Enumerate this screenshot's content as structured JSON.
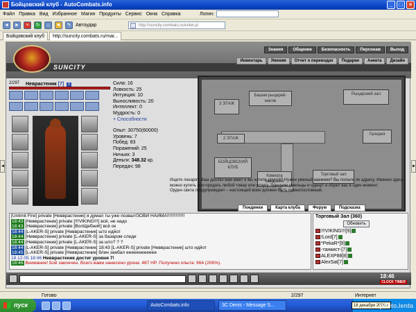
{
  "window": {
    "title": "Бойцовский клуб - AutoCombats.info"
  },
  "menu": [
    "Файл",
    "Правка",
    "Вид",
    "Избранное",
    "Магия",
    "Продукты",
    "Сервис",
    "Окна",
    "Справка"
  ],
  "logon_label": "Логин:",
  "toolbar": {
    "autocomplete": "Автоудар"
  },
  "address": "http://suncity.combats.ru/enter.pl",
  "tabs": [
    "Бойцовский клуб",
    "http://suncity.combats.ru/mai..."
  ],
  "site": {
    "brand": "SUNCITY",
    "top_links": [
      "Знания",
      "Общение",
      "Безопасность",
      "Персонаж",
      "Выход"
    ],
    "sub_links": [
      "Инвентарь",
      "Умения",
      "Отчет о переводах",
      "Подарки",
      "Анкета",
      "Дизайн"
    ]
  },
  "character": {
    "name": "Неврастеник",
    "level": "[7]",
    "hp": "2/297",
    "stats": [
      "Сила: 16",
      "Ловкость: 25",
      "Интуиция: 10",
      "Выносливость: 20",
      "Интеллект: 0",
      "Мудрость: 0"
    ],
    "abilities_link": "+ Способности",
    "info": [
      "Опыт: 30750(60000)",
      "Уровень: 7",
      "Побед: 83",
      "Поражений: 25",
      "Ничьих: 3"
    ],
    "money_label": "Деньги:",
    "money": "348.32",
    "money_unit": "кр.",
    "transfers": "Передач: 98"
  },
  "map": {
    "rooms": {
      "floor3": "3 ЭТАЖ",
      "knights": "Башня рыцарей-магов",
      "knight_hall": "Рыцарский зал",
      "floor2": "2 ЭТАЖ",
      "gallery": "Галерея",
      "club": "БОЙЦОВСКИЙ КЛУБ",
      "waiting": "Комната ожидания",
      "trade": "Торговый зал"
    },
    "description": "Ищете лекаря? Ваш доспех вам жмет и вы хотите другой? Нужен умелый наемник? Вы попали по адресу. Именно здесь можно купить или продать любой товар или услугу. Здешние умельцы и оденут и обуют вас в один момент.",
    "warning": "Орден света предупреждает – настоящий воин должен быть немногословным."
  },
  "nav_buttons": [
    "Поединки",
    "Карта клуба",
    "Форум",
    "Подсказка"
  ],
  "chat": [
    {
      "time": "",
      "text": "[Unlimit Fire] private [Невврастеник] я думал ты уже позвал!ЗОВИ НАЙМА!!!!!!!!!!!!!!"
    },
    {
      "time": "18:43",
      "text": "[Невврастеник] private [!!!VIKING!!!] всё, не надо"
    },
    {
      "time": "18:43",
      "text": "[Невврастеник] private [BoлЩебниК] всё ок"
    },
    {
      "time": "18:44",
      "text": "[L-AKER-S] private [Невврастеник] што идйот"
    },
    {
      "time": "18:44",
      "text": "[Невврастеник] private [L-AKER-S] за базаром следи"
    },
    {
      "time": "18:44",
      "text": "[Невврастеник] private [L-AKER-S] за што? ? ?"
    },
    {
      "time": "18:44",
      "text": "[L-AKER-S] private [Невврастеник] 18:43 [L-AKER-S] private [Невврастеник] што идйот"
    },
    {
      "time": "18:45",
      "text": "[L-AKER-S] private [Невврастеник] блин заебал ееееееееееее"
    },
    {
      "time": "18.12.05 18:46",
      "text": "Невврастеник достиг уровня 7!"
    },
    {
      "time": "18:46",
      "text": "Внимание! Бой закончен. Всего вами нанесено урона: 487 HP. Получено опыта: 964 (206%)."
    }
  ],
  "room_panel": {
    "title": "Торговый Зал (360)",
    "refresh": "Обновить",
    "users": [
      "!!!VIKING!!![9]",
      "!Lord[7]",
      "*PekaR*[9]",
      "-танкист-[7]",
      "ALEXP88[8]",
      "AlexSat[7]"
    ]
  },
  "clock": {
    "time": "18:46",
    "caption": "CLOCK TIMER"
  },
  "statusbar": {
    "status": "Готово",
    "counter": "2/297",
    "zone": "Интернет"
  },
  "taskbar": {
    "start": "пуск",
    "tasks": [
      "AutoCombats.info",
      "3C Denis - Message S..."
    ],
    "date": "18 декабря 2005 г."
  },
  "watermark": "photo.lenta"
}
